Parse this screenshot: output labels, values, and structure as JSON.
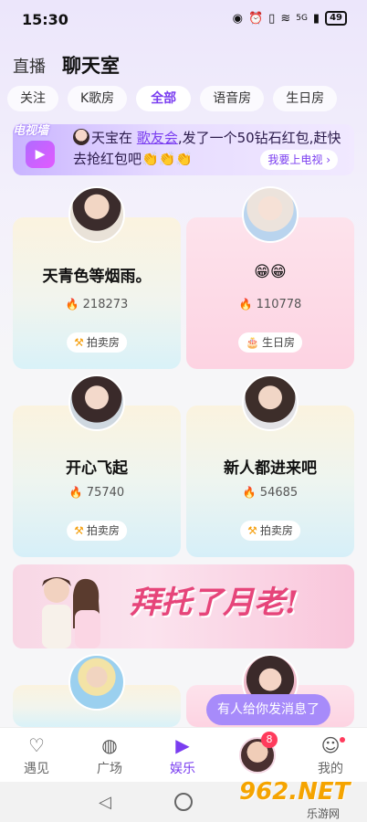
{
  "status_bar": {
    "time": "15:30",
    "battery": "49",
    "network": "5G"
  },
  "top_nav": {
    "live": "直播",
    "chatroom": "聊天室"
  },
  "tabs": [
    "关注",
    "K歌房",
    "全部",
    "语音房",
    "生日房"
  ],
  "tv_banner": {
    "tag": "电视墙",
    "user": "天宝",
    "text_prefix": "在",
    "link": "歌友会",
    "text_rest": ",发了一个50钻石红包,赶快去抢红包吧👏👏👏",
    "button": "我要上电视 ›"
  },
  "rooms": [
    {
      "title": "天青色等烟雨。",
      "count": "218273",
      "tag": "拍卖房"
    },
    {
      "title": "😁😁",
      "count": "110778",
      "tag": "生日房"
    },
    {
      "title": "开心飞起",
      "count": "75740",
      "tag": "拍卖房"
    },
    {
      "title": "新人都进来吧",
      "count": "54685",
      "tag": "拍卖房"
    }
  ],
  "promo": {
    "text": "拜托了月老!"
  },
  "toast": {
    "text": "有人给你发消息了"
  },
  "bottom_nav": {
    "items": [
      "遇见",
      "广场",
      "娱乐",
      "我的"
    ],
    "badge": "8",
    "icons": [
      "heartbeat-icon",
      "planet-icon",
      "play-icon",
      "profile-icon"
    ]
  },
  "watermark": {
    "main": "962.NET",
    "sub": "乐游网"
  },
  "colors": {
    "accent": "#7a3df0",
    "toast": "#a78bfa",
    "fire": "#ff5a3c"
  }
}
